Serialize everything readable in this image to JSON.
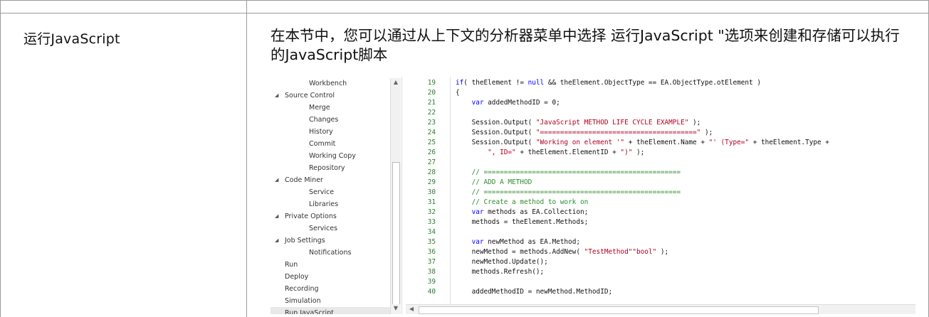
{
  "row": {
    "label": "运行JavaScript",
    "description": "在本节中，您可以通过从上下文的分析器菜单中选择 运行JavaScript \"选项来创建和存储可以执行的JavaScript脚本"
  },
  "tree": {
    "items": [
      {
        "label": "Workbench",
        "indent": 2,
        "arrow": false,
        "selected": false
      },
      {
        "label": "Source Control",
        "indent": 1,
        "arrow": true,
        "selected": false
      },
      {
        "label": "Merge",
        "indent": 2,
        "arrow": false,
        "selected": false
      },
      {
        "label": "Changes",
        "indent": 2,
        "arrow": false,
        "selected": false
      },
      {
        "label": "History",
        "indent": 2,
        "arrow": false,
        "selected": false
      },
      {
        "label": "Commit",
        "indent": 2,
        "arrow": false,
        "selected": false
      },
      {
        "label": "Working Copy",
        "indent": 2,
        "arrow": false,
        "selected": false
      },
      {
        "label": "Repository",
        "indent": 2,
        "arrow": false,
        "selected": false
      },
      {
        "label": "Code Miner",
        "indent": 1,
        "arrow": true,
        "selected": false
      },
      {
        "label": "Service",
        "indent": 2,
        "arrow": false,
        "selected": false
      },
      {
        "label": "Libraries",
        "indent": 2,
        "arrow": false,
        "selected": false
      },
      {
        "label": "Private Options",
        "indent": 1,
        "arrow": true,
        "selected": false
      },
      {
        "label": "Services",
        "indent": 2,
        "arrow": false,
        "selected": false
      },
      {
        "label": "Job Settings",
        "indent": 1,
        "arrow": true,
        "selected": false
      },
      {
        "label": "Notifications",
        "indent": 2,
        "arrow": false,
        "selected": false
      },
      {
        "label": "Run",
        "indent": 1,
        "arrow": false,
        "selected": false
      },
      {
        "label": "Deploy",
        "indent": 1,
        "arrow": false,
        "selected": false
      },
      {
        "label": "Recording",
        "indent": 1,
        "arrow": false,
        "selected": false
      },
      {
        "label": "Simulation",
        "indent": 1,
        "arrow": false,
        "selected": false
      },
      {
        "label": "Run JavaScript",
        "indent": 1,
        "arrow": false,
        "selected": true
      }
    ]
  },
  "code": {
    "lines": [
      {
        "n": "19",
        "segs": [
          [
            "kw",
            "if"
          ],
          [
            "",
            "( theElement != "
          ],
          [
            "kw",
            "null"
          ],
          [
            "",
            " && theElement.ObjectType == EA.ObjectType.otElement )"
          ]
        ]
      },
      {
        "n": "20",
        "segs": [
          [
            "",
            "{"
          ]
        ]
      },
      {
        "n": "21",
        "segs": [
          [
            "",
            "    "
          ],
          [
            "kw",
            "var"
          ],
          [
            "",
            " addedMethodID = 0;"
          ]
        ]
      },
      {
        "n": "22",
        "segs": []
      },
      {
        "n": "23",
        "segs": [
          [
            "",
            "    Session.Output( "
          ],
          [
            "str",
            "\"JavaScript METHOD LIFE CYCLE EXAMPLE\""
          ],
          [
            "",
            " );"
          ]
        ]
      },
      {
        "n": "24",
        "segs": [
          [
            "",
            "    Session.Output( "
          ],
          [
            "str",
            "\"=======================================\""
          ],
          [
            "",
            " );"
          ]
        ]
      },
      {
        "n": "25",
        "segs": [
          [
            "",
            "    Session.Output( "
          ],
          [
            "str",
            "\"Working on element '\""
          ],
          [
            "",
            " + theElement.Name + "
          ],
          [
            "str",
            "\"' (Type=\""
          ],
          [
            "",
            " + theElement.Type +"
          ]
        ]
      },
      {
        "n": "26",
        "segs": [
          [
            "",
            "        "
          ],
          [
            "str",
            "\", ID=\""
          ],
          [
            "",
            " + theElement.ElementID + "
          ],
          [
            "str",
            "\")\""
          ],
          [
            "",
            " );"
          ]
        ]
      },
      {
        "n": "27",
        "segs": []
      },
      {
        "n": "28",
        "segs": [
          [
            "cmt",
            "    // ================================================="
          ]
        ]
      },
      {
        "n": "29",
        "segs": [
          [
            "cmt",
            "    // ADD A METHOD"
          ]
        ]
      },
      {
        "n": "30",
        "segs": [
          [
            "cmt",
            "    // ================================================="
          ]
        ]
      },
      {
        "n": "31",
        "segs": [
          [
            "cmt",
            "    // Create a method to work on"
          ]
        ]
      },
      {
        "n": "32",
        "segs": [
          [
            "",
            "    "
          ],
          [
            "kw",
            "var"
          ],
          [
            "",
            " methods as EA.Collection;"
          ]
        ]
      },
      {
        "n": "33",
        "segs": [
          [
            "",
            "    methods = theElement.Methods;"
          ]
        ]
      },
      {
        "n": "34",
        "segs": []
      },
      {
        "n": "35",
        "segs": [
          [
            "",
            "    "
          ],
          [
            "kw",
            "var"
          ],
          [
            "",
            " newMethod as EA.Method;"
          ]
        ]
      },
      {
        "n": "36",
        "segs": [
          [
            "",
            "    newMethod = methods.AddNew( "
          ],
          [
            "str",
            "\"TestMethod\""
          ],
          [
            ", "
          ],
          [
            "str",
            "\"bool\""
          ],
          [
            "",
            " );"
          ]
        ]
      },
      {
        "n": "37",
        "segs": [
          [
            "",
            "    newMethod.Update();"
          ]
        ]
      },
      {
        "n": "38",
        "segs": [
          [
            "",
            "    methods.Refresh();"
          ]
        ]
      },
      {
        "n": "39",
        "segs": []
      },
      {
        "n": "40",
        "segs": [
          [
            "",
            "    addedMethodID = newMethod.MethodID;"
          ]
        ]
      }
    ]
  },
  "colors": {
    "keyword": "#0000ff",
    "string": "#b00020",
    "comment": "#2e8b2e",
    "line_number": "#2e7d32"
  },
  "icons": {
    "tree_expand": "triangle-down-icon",
    "scroll_up": "scroll-up-arrow-icon",
    "scroll_down": "scroll-down-arrow-icon",
    "scroll_left": "scroll-left-arrow-icon"
  }
}
